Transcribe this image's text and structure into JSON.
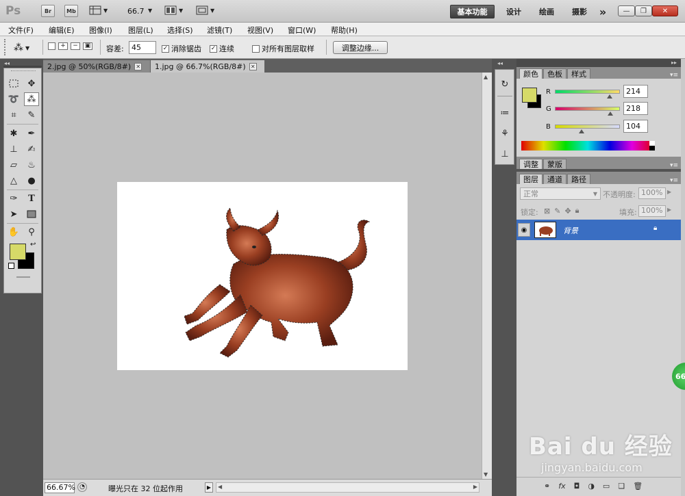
{
  "app": {
    "logo": "Ps",
    "toolbar": {
      "br": "Br",
      "mb": "Mb",
      "zoom": "66.7",
      "workspaces": [
        "基本功能",
        "设计",
        "绘画",
        "摄影"
      ],
      "more": "»"
    }
  },
  "menu": [
    "文件(F)",
    "编辑(E)",
    "图像(I)",
    "图层(L)",
    "选择(S)",
    "滤镜(T)",
    "视图(V)",
    "窗口(W)",
    "帮助(H)"
  ],
  "options": {
    "tolerance_label": "容差:",
    "tolerance_value": "45",
    "antialias_label": "消除锯齿",
    "contiguous_label": "连续",
    "sample_all_label": "对所有图层取样",
    "refine_edge_label": "调整边缘..."
  },
  "tabs": [
    {
      "label": "2.jpg @ 50%(RGB/8#)",
      "active": false
    },
    {
      "label": "1.jpg @ 66.7%(RGB/8#)",
      "active": true
    }
  ],
  "status": {
    "zoom": "66.67%",
    "message": "曝光只在 32 位起作用"
  },
  "color_panel": {
    "tabs": [
      "颜色",
      "色板",
      "样式"
    ],
    "r_label": "R",
    "r_value": "214",
    "g_label": "G",
    "g_value": "218",
    "b_label": "B",
    "b_value": "104",
    "foreground": "#d6da68",
    "background": "#000000",
    "r_fraction": 0.84,
    "g_fraction": 0.85,
    "b_fraction": 0.41
  },
  "adjust_panel": {
    "tabs": [
      "调整",
      "蒙版"
    ]
  },
  "layers_panel": {
    "tabs": [
      "图层",
      "通道",
      "路径"
    ],
    "blend_mode": "正常",
    "opacity_label": "不透明度:",
    "opacity_value": "100%",
    "lock_label": "锁定:",
    "fill_label": "填充:",
    "fill_value": "100%",
    "layers": [
      {
        "name": "背景",
        "selected": true,
        "locked": true
      }
    ]
  },
  "watermark": {
    "brand": "Bai du 经验",
    "url": "jingyan.baidu.com",
    "badge": "66"
  }
}
